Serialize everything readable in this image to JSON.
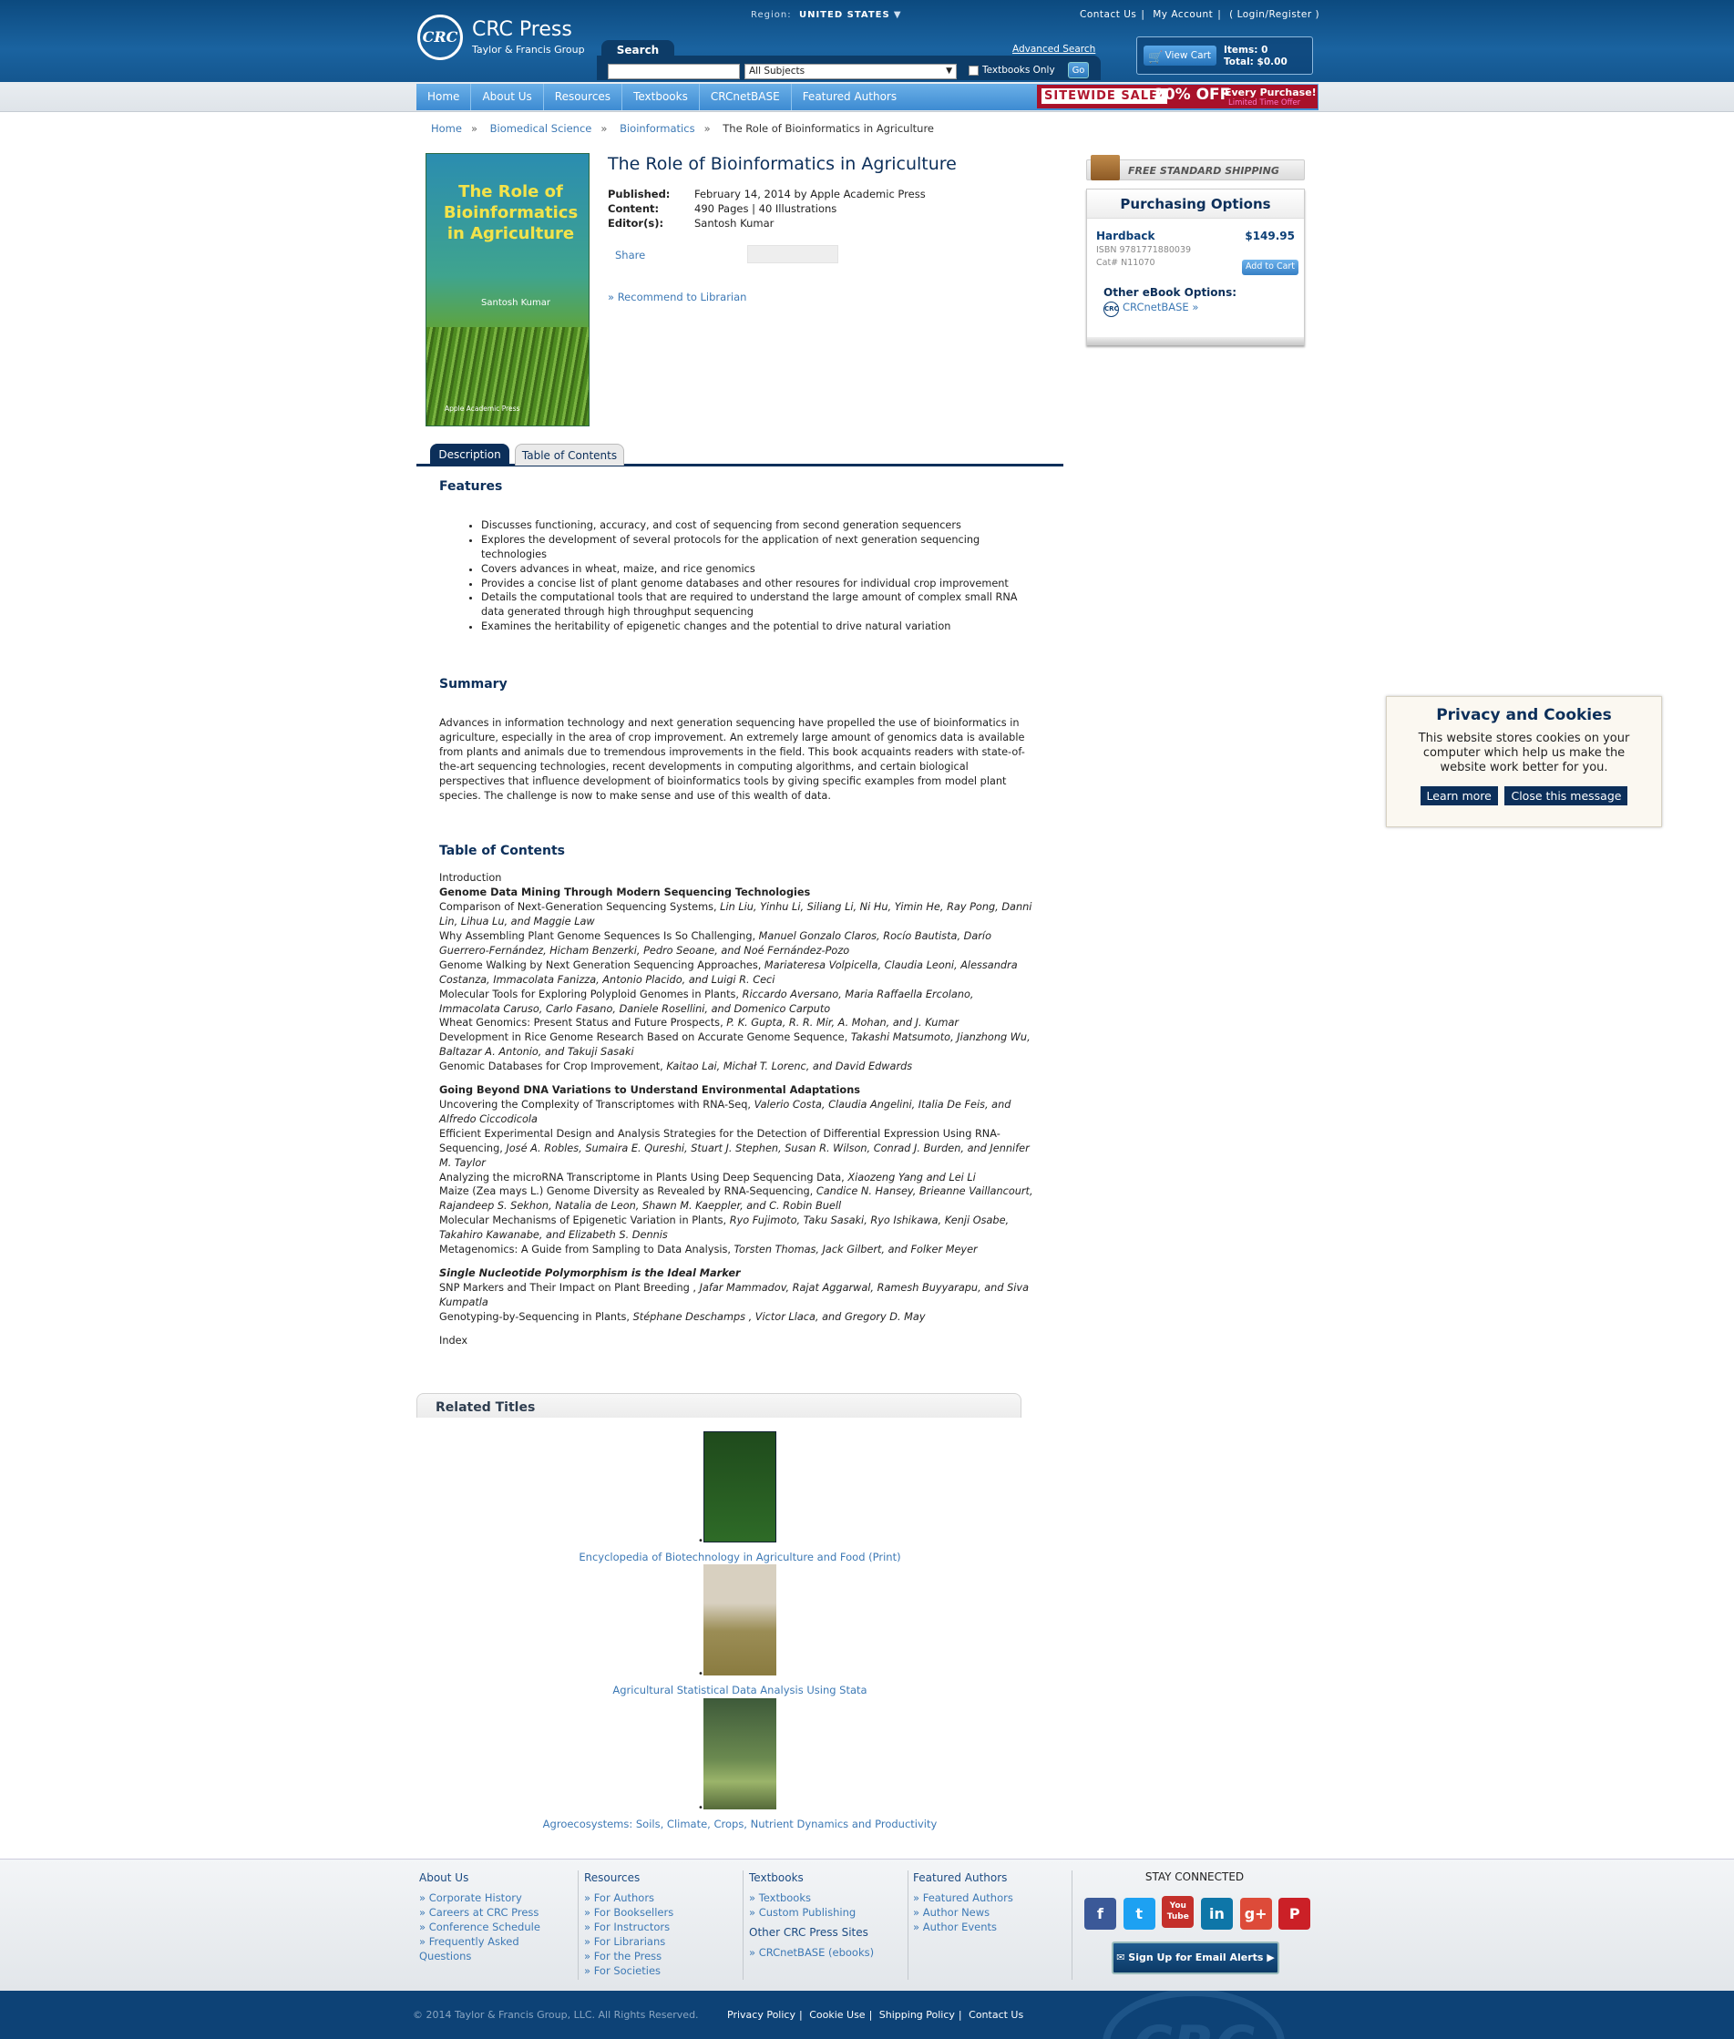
{
  "header": {
    "logo_mark": "CRC",
    "brand": "CRC Press",
    "brand_sub": "Taylor & Francis Group",
    "region_label": "Region:",
    "region_value": "UNITED STATES",
    "top_links": [
      "Contact Us",
      "My Account",
      "( Login/Register )"
    ],
    "search_tab": "Search",
    "search_placeholder": "",
    "subject_select": "All Subjects",
    "advanced_search": "Advanced Search",
    "textbooks_only": "Textbooks Only",
    "go": "Go",
    "cart_button": "View Cart",
    "cart_items": "Items: 0",
    "cart_total": "Total: $0.00"
  },
  "nav": {
    "items": [
      "Home",
      "About Us",
      "Resources",
      "Textbooks",
      "CRCnetBASE",
      "Featured Authors"
    ],
    "sale_badge": "SITEWIDE SALE!",
    "sale_pct": "20% OFF",
    "sale_text": "Every Purchase!",
    "sale_sub": "Limited Time Offer"
  },
  "breadcrumb": [
    "Home",
    "Biomedical Science",
    "Bioinformatics",
    "The Role of Bioinformatics in Agriculture"
  ],
  "book": {
    "cover_title": "The Role of Bioinformatics in Agriculture",
    "cover_author": "Santosh Kumar",
    "cover_publisher": "Apple Academic Press",
    "title": "The Role of Bioinformatics in Agriculture",
    "published_label": "Published:",
    "published": "February 14, 2014 by Apple Academic Press",
    "content_label": "Content:",
    "content": "490 Pages | 40 Illustrations",
    "editor_label": "Editor(s):",
    "editor": "Santosh Kumar",
    "share": "Share",
    "recommend": "» Recommend to Librarian"
  },
  "purchase": {
    "shipping": "FREE STANDARD SHIPPING",
    "heading": "Purchasing Options",
    "format": "Hardback",
    "price": "$149.95",
    "isbn": "ISBN 9781771880039",
    "cat": "Cat# N11070",
    "add_to_cart": "Add to Cart",
    "ebook_heading": "Other eBook Options:",
    "ebook_logo": "CRC",
    "ebook_link": "CRCnetBASE »"
  },
  "tabs": [
    "Description",
    "Table of Contents"
  ],
  "features": {
    "heading": "Features",
    "items": [
      "Discusses functioning, accuracy, and cost of sequencing from second generation sequencers",
      "Explores the development of several protocols for the application of next generation sequencing technologies",
      "Covers advances in wheat, maize, and rice genomics",
      "Provides a concise list of plant genome databases and other resoures for individual crop improvement",
      "Details the computational tools that are required to understand the large amount of complex small RNA data generated through high throughput sequencing",
      "Examines the heritability of epigenetic changes and the potential to drive natural variation"
    ]
  },
  "summary": {
    "heading": "Summary",
    "text": "Advances in information technology and next generation sequencing have propelled the use of bioinformatics in agriculture, especially in the area of crop improvement. An extremely large amount of genomics data is available from plants and animals due to tremendous improvements in the field. This book acquaints readers with state-of-the-art sequencing technologies, recent developments in computing algorithms, and certain biological perspectives that influence development of bioinformatics tools by giving specific examples from model plant species. The challenge is now to make sense and use of this wealth of data."
  },
  "toc": {
    "heading": "Table of Contents",
    "intro": "Introduction",
    "part1": "Genome Data Mining Through Modern Sequencing Technologies",
    "p1": [
      {
        "t": "Comparison of Next-Generation Sequencing Systems, ",
        "a": "Lin Liu, Yinhu Li, Siliang Li, Ni Hu, Yimin He, Ray Pong, Danni Lin, Lihua Lu, and Maggie Law"
      },
      {
        "t": "Why Assembling Plant Genome Sequences Is So Challenging, ",
        "a": "Manuel Gonzalo Claros, Rocío Bautista, Darío Guerrero-Fernández, Hicham Benzerki, Pedro Seoane, and Noé Fernández-Pozo"
      },
      {
        "t": "Genome Walking by Next Generation Sequencing Approaches, ",
        "a": "Mariateresa Volpicella, Claudia Leoni, Alessandra Costanza, Immacolata Fanizza, Antonio Placido, and Luigi R. Ceci"
      },
      {
        "t": "Molecular Tools for Exploring Polyploid Genomes in Plants, ",
        "a": "Riccardo Aversano, Maria Raffaella Ercolano, Immacolata Caruso, Carlo Fasano, Daniele Rosellini, and Domenico Carputo"
      },
      {
        "t": "Wheat Genomics: Present Status and Future Prospects, ",
        "a": "P. K. Gupta, R. R. Mir, A. Mohan, and J. Kumar"
      },
      {
        "t": "Development in Rice Genome Research Based on Accurate Genome Sequence, ",
        "a": "Takashi Matsumoto, Jianzhong Wu, Baltazar A. Antonio, and Takuji Sasaki"
      },
      {
        "t": "Genomic Databases for Crop Improvement, ",
        "a": "Kaitao Lai, Michał T. Lorenc, and David Edwards"
      }
    ],
    "part2": "Going Beyond DNA Variations to Understand Environmental Adaptations",
    "p2": [
      {
        "t": "Uncovering the Complexity of Transcriptomes with RNA-Seq, ",
        "a": "Valerio Costa, Claudia Angelini, Italia De Feis, and Alfredo Ciccodicola"
      },
      {
        "t": "Efficient Experimental Design and Analysis Strategies for the Detection of Differential Expression Using RNA-Sequencing, ",
        "a": "José A. Robles, Sumaira E. Qureshi, Stuart J. Stephen, Susan R. Wilson, Conrad J. Burden, and Jennifer M. Taylor"
      },
      {
        "t": "Analyzing the microRNA Transcriptome in Plants Using Deep Sequencing Data, ",
        "a": "Xiaozeng Yang and Lei Li"
      },
      {
        "t": "Maize (Zea mays L.) Genome Diversity as Revealed by RNA-Sequencing, ",
        "a": "Candice N. Hansey, Brieanne Vaillancourt, Rajandeep S. Sekhon, Natalia de Leon, Shawn M. Kaeppler, and C. Robin Buell"
      },
      {
        "t": "Molecular Mechanisms of Epigenetic Variation in Plants, ",
        "a": "Ryo Fujimoto, Taku Sasaki, Ryo Ishikawa, Kenji Osabe, Takahiro Kawanabe, and Elizabeth S. Dennis"
      },
      {
        "t": "Metagenomics: A Guide from Sampling to Data Analysis, ",
        "a": "Torsten Thomas, Jack Gilbert, and Folker Meyer"
      }
    ],
    "part3": "Single Nucleotide Polymorphism is the Ideal Marker",
    "p3": [
      {
        "t": "SNP Markers and Their Impact on Plant Breeding , ",
        "a": "Jafar Mammadov, Rajat Aggarwal, Ramesh Buyyarapu, and Siva Kumpatla"
      },
      {
        "t": "Genotyping-by-Sequencing in Plants, ",
        "a": "Stéphane Deschamps , Victor Llaca, and Gregory D. May"
      }
    ],
    "index": "Index"
  },
  "cookie": {
    "heading": "Privacy and Cookies",
    "text": "This website stores cookies on your computer which help us make the website work better for you.",
    "learn_more": "Learn more",
    "close": "Close this message"
  },
  "related": {
    "heading": "Related Titles",
    "items": [
      "Encyclopedia of Biotechnology in Agriculture and Food (Print)",
      "Agricultural Statistical Data Analysis Using Stata",
      "Agroecosystems: Soils, Climate, Crops, Nutrient Dynamics and Productivity"
    ]
  },
  "footer": {
    "about": {
      "heading": "About Us",
      "links": [
        "Corporate History",
        "Careers at CRC Press",
        "Conference Schedule",
        "Frequently Asked Questions"
      ]
    },
    "resources": {
      "heading": "Resources",
      "links": [
        "For Authors",
        "For Booksellers",
        "For Instructors",
        "For Librarians",
        "For the Press",
        "For Societies"
      ]
    },
    "textbooks": {
      "heading": "Textbooks",
      "links": [
        "Textbooks",
        "Custom Publishing"
      ],
      "other_heading": "Other CRC Press Sites",
      "other_links": [
        "CRCnetBASE (ebooks)"
      ]
    },
    "featured": {
      "heading": "Featured Authors",
      "links": [
        "Featured Authors",
        "Author News",
        "Author Events"
      ]
    },
    "stay_connected": "STAY CONNECTED",
    "social": [
      "f",
      "t",
      "You Tube",
      "in",
      "g+",
      "P"
    ],
    "email_signup": "Sign Up for Email Alerts",
    "copyright": "© 2014 Taylor & Francis Group, LLC. All Rights Reserved.",
    "bottom_links": [
      "Privacy Policy",
      "Cookie Use",
      "Shipping Policy",
      "Contact Us"
    ]
  },
  "colors": {
    "navy": "#0c2f5a",
    "link": "#3d79b5",
    "header": "#14568f",
    "sale": "#a8112a"
  }
}
